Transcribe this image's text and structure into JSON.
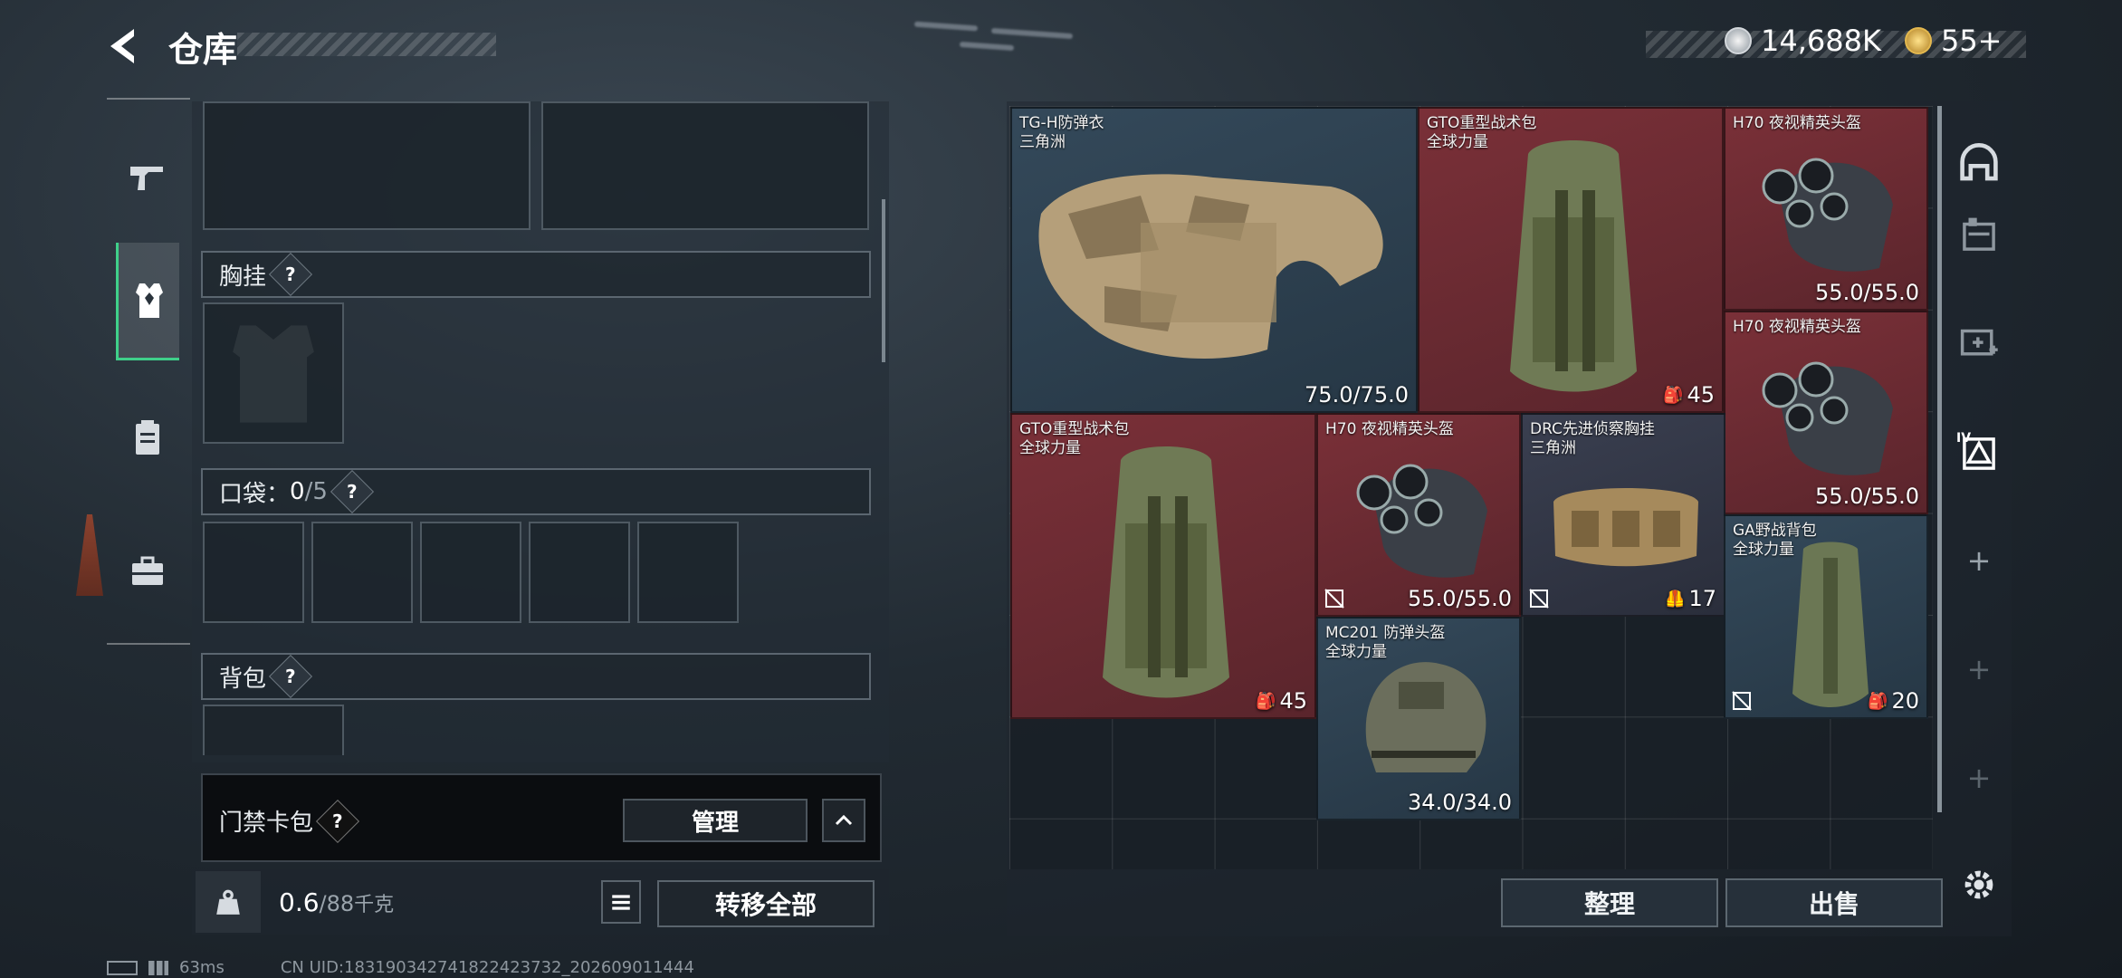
{
  "header": {
    "title": "仓库",
    "currency_amount": "14,688K",
    "coin_amount": "55+"
  },
  "left_tabs": [
    {
      "name": "weapons"
    },
    {
      "name": "equipment"
    },
    {
      "name": "consumables"
    },
    {
      "name": "keys"
    }
  ],
  "sections": {
    "chest_rig": "胸挂",
    "pocket_label": "口袋：",
    "pocket_count": "0",
    "pocket_total": "/5",
    "backpack": "背包",
    "keycard_pack": "门禁卡包",
    "question": "?"
  },
  "keycard": {
    "manage_label": "管理"
  },
  "bottom": {
    "weight_current": "0.6",
    "weight_total": "/88",
    "weight_unit": "千克",
    "transfer_all_label": "转移全部"
  },
  "inventory": {
    "items": [
      {
        "name": "TG-H防弹衣",
        "sub": "三角洲",
        "durability": "75.0/75.0"
      },
      {
        "name": "GTO重型战术包",
        "sub": "全球力量",
        "count": "45"
      },
      {
        "name": "H70 夜视精英头盔",
        "durability": "55.0/55.0"
      },
      {
        "name": "H70 夜视精英头盔",
        "durability": "55.0/55.0"
      },
      {
        "name": "GTO重型战术包",
        "sub": "全球力量",
        "count": "45"
      },
      {
        "name": "H70 夜视精英头盔",
        "durability": "55.0/55.0"
      },
      {
        "name": "DRC先进侦察胸挂",
        "sub": "三角洲",
        "count": "17"
      },
      {
        "name": "GA野战背包",
        "sub": "全球力量",
        "count": "20"
      },
      {
        "name": "MC201 防弹头盔",
        "sub": "全球力量",
        "durability": "34.0/34.0"
      }
    ],
    "sort_label": "整理",
    "sell_label": "出售"
  },
  "right_tabs": {
    "level_badge": "IV"
  },
  "status": {
    "ping": "63ms",
    "uid": "CN UID:18319034274182242373​2_202609011444"
  },
  "colors": {
    "red_slot": "#6b2a31",
    "blue_slot": "#2e4252",
    "accent_green": "#3fd08a"
  }
}
